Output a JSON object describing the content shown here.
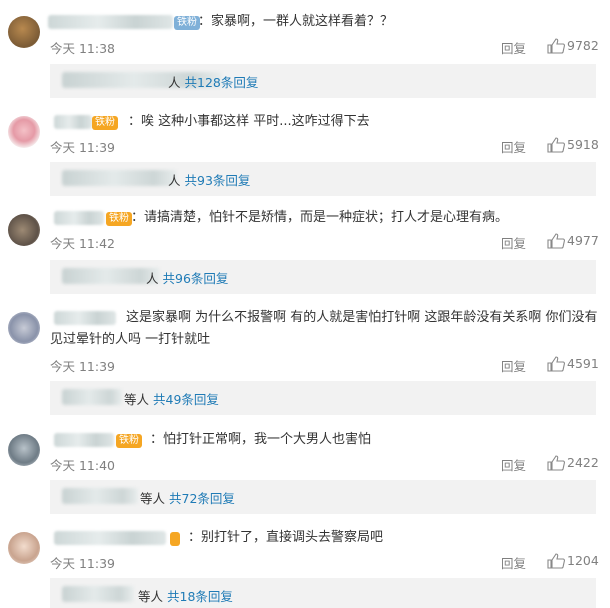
{
  "comments": [
    {
      "fans_label": "铁粉",
      "text": "：家暴啊，一群人就这样看着？？",
      "time": "今天 11:38",
      "reply_label": "回复",
      "likes": "9782",
      "sub_prefix": "人",
      "sub_count": "共128条回复"
    },
    {
      "fans_label": "铁粉",
      "text": "：唉 这种小事都这样 平时...这咋过得下去",
      "time": "今天 11:39",
      "reply_label": "回复",
      "likes": "5918",
      "sub_prefix": "人",
      "sub_count": "共93条回复"
    },
    {
      "fans_label": "铁粉",
      "text": "：请搞清楚，怕针不是矫情，而是一种症状；打人才是心理有病。",
      "time": "今天 11:42",
      "reply_label": "回复",
      "likes": "4977",
      "sub_prefix": "人",
      "sub_count": "共96条回复"
    },
    {
      "fans_label": "",
      "text": "这是家暴啊 为什么不报警啊 有的人就是害怕打针啊 这跟年龄没有关系啊 你们没有见过晕针的人吗 一打针就吐",
      "time": "今天 11:39",
      "reply_label": "回复",
      "likes": "4591",
      "sub_prefix": "等人",
      "sub_count": "共49条回复"
    },
    {
      "fans_label": "铁粉",
      "text": "：怕打针正常啊，我一个大男人也害怕",
      "time": "今天 11:40",
      "reply_label": "回复",
      "likes": "2422",
      "sub_prefix": "等人",
      "sub_count": "共72条回复"
    },
    {
      "fans_label": "",
      "text": "：别打针了，直接调头去警察局吧",
      "time": "今天 11:39",
      "reply_label": "回复",
      "likes": "1204",
      "sub_prefix": "等人",
      "sub_count": "共18条回复"
    }
  ],
  "icons": {
    "like": "thumbs-up-icon",
    "avatar": "avatar"
  },
  "colors": {
    "link": "#1f7bb6",
    "meta": "#808080",
    "badge": "#f5a623"
  }
}
